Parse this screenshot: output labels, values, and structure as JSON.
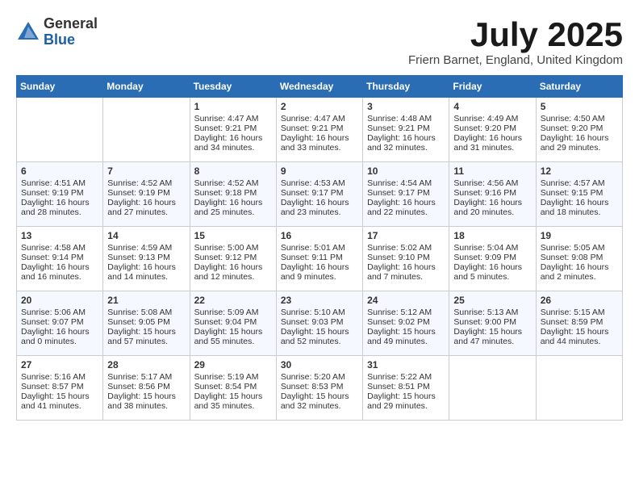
{
  "header": {
    "logo_general": "General",
    "logo_blue": "Blue",
    "title": "July 2025",
    "location": "Friern Barnet, England, United Kingdom"
  },
  "days_of_week": [
    "Sunday",
    "Monday",
    "Tuesday",
    "Wednesday",
    "Thursday",
    "Friday",
    "Saturday"
  ],
  "weeks": [
    [
      {
        "day": "",
        "content": ""
      },
      {
        "day": "",
        "content": ""
      },
      {
        "day": "1",
        "content": "Sunrise: 4:47 AM\nSunset: 9:21 PM\nDaylight: 16 hours and 34 minutes."
      },
      {
        "day": "2",
        "content": "Sunrise: 4:47 AM\nSunset: 9:21 PM\nDaylight: 16 hours and 33 minutes."
      },
      {
        "day": "3",
        "content": "Sunrise: 4:48 AM\nSunset: 9:21 PM\nDaylight: 16 hours and 32 minutes."
      },
      {
        "day": "4",
        "content": "Sunrise: 4:49 AM\nSunset: 9:20 PM\nDaylight: 16 hours and 31 minutes."
      },
      {
        "day": "5",
        "content": "Sunrise: 4:50 AM\nSunset: 9:20 PM\nDaylight: 16 hours and 29 minutes."
      }
    ],
    [
      {
        "day": "6",
        "content": "Sunrise: 4:51 AM\nSunset: 9:19 PM\nDaylight: 16 hours and 28 minutes."
      },
      {
        "day": "7",
        "content": "Sunrise: 4:52 AM\nSunset: 9:19 PM\nDaylight: 16 hours and 27 minutes."
      },
      {
        "day": "8",
        "content": "Sunrise: 4:52 AM\nSunset: 9:18 PM\nDaylight: 16 hours and 25 minutes."
      },
      {
        "day": "9",
        "content": "Sunrise: 4:53 AM\nSunset: 9:17 PM\nDaylight: 16 hours and 23 minutes."
      },
      {
        "day": "10",
        "content": "Sunrise: 4:54 AM\nSunset: 9:17 PM\nDaylight: 16 hours and 22 minutes."
      },
      {
        "day": "11",
        "content": "Sunrise: 4:56 AM\nSunset: 9:16 PM\nDaylight: 16 hours and 20 minutes."
      },
      {
        "day": "12",
        "content": "Sunrise: 4:57 AM\nSunset: 9:15 PM\nDaylight: 16 hours and 18 minutes."
      }
    ],
    [
      {
        "day": "13",
        "content": "Sunrise: 4:58 AM\nSunset: 9:14 PM\nDaylight: 16 hours and 16 minutes."
      },
      {
        "day": "14",
        "content": "Sunrise: 4:59 AM\nSunset: 9:13 PM\nDaylight: 16 hours and 14 minutes."
      },
      {
        "day": "15",
        "content": "Sunrise: 5:00 AM\nSunset: 9:12 PM\nDaylight: 16 hours and 12 minutes."
      },
      {
        "day": "16",
        "content": "Sunrise: 5:01 AM\nSunset: 9:11 PM\nDaylight: 16 hours and 9 minutes."
      },
      {
        "day": "17",
        "content": "Sunrise: 5:02 AM\nSunset: 9:10 PM\nDaylight: 16 hours and 7 minutes."
      },
      {
        "day": "18",
        "content": "Sunrise: 5:04 AM\nSunset: 9:09 PM\nDaylight: 16 hours and 5 minutes."
      },
      {
        "day": "19",
        "content": "Sunrise: 5:05 AM\nSunset: 9:08 PM\nDaylight: 16 hours and 2 minutes."
      }
    ],
    [
      {
        "day": "20",
        "content": "Sunrise: 5:06 AM\nSunset: 9:07 PM\nDaylight: 16 hours and 0 minutes."
      },
      {
        "day": "21",
        "content": "Sunrise: 5:08 AM\nSunset: 9:05 PM\nDaylight: 15 hours and 57 minutes."
      },
      {
        "day": "22",
        "content": "Sunrise: 5:09 AM\nSunset: 9:04 PM\nDaylight: 15 hours and 55 minutes."
      },
      {
        "day": "23",
        "content": "Sunrise: 5:10 AM\nSunset: 9:03 PM\nDaylight: 15 hours and 52 minutes."
      },
      {
        "day": "24",
        "content": "Sunrise: 5:12 AM\nSunset: 9:02 PM\nDaylight: 15 hours and 49 minutes."
      },
      {
        "day": "25",
        "content": "Sunrise: 5:13 AM\nSunset: 9:00 PM\nDaylight: 15 hours and 47 minutes."
      },
      {
        "day": "26",
        "content": "Sunrise: 5:15 AM\nSunset: 8:59 PM\nDaylight: 15 hours and 44 minutes."
      }
    ],
    [
      {
        "day": "27",
        "content": "Sunrise: 5:16 AM\nSunset: 8:57 PM\nDaylight: 15 hours and 41 minutes."
      },
      {
        "day": "28",
        "content": "Sunrise: 5:17 AM\nSunset: 8:56 PM\nDaylight: 15 hours and 38 minutes."
      },
      {
        "day": "29",
        "content": "Sunrise: 5:19 AM\nSunset: 8:54 PM\nDaylight: 15 hours and 35 minutes."
      },
      {
        "day": "30",
        "content": "Sunrise: 5:20 AM\nSunset: 8:53 PM\nDaylight: 15 hours and 32 minutes."
      },
      {
        "day": "31",
        "content": "Sunrise: 5:22 AM\nSunset: 8:51 PM\nDaylight: 15 hours and 29 minutes."
      },
      {
        "day": "",
        "content": ""
      },
      {
        "day": "",
        "content": ""
      }
    ]
  ]
}
